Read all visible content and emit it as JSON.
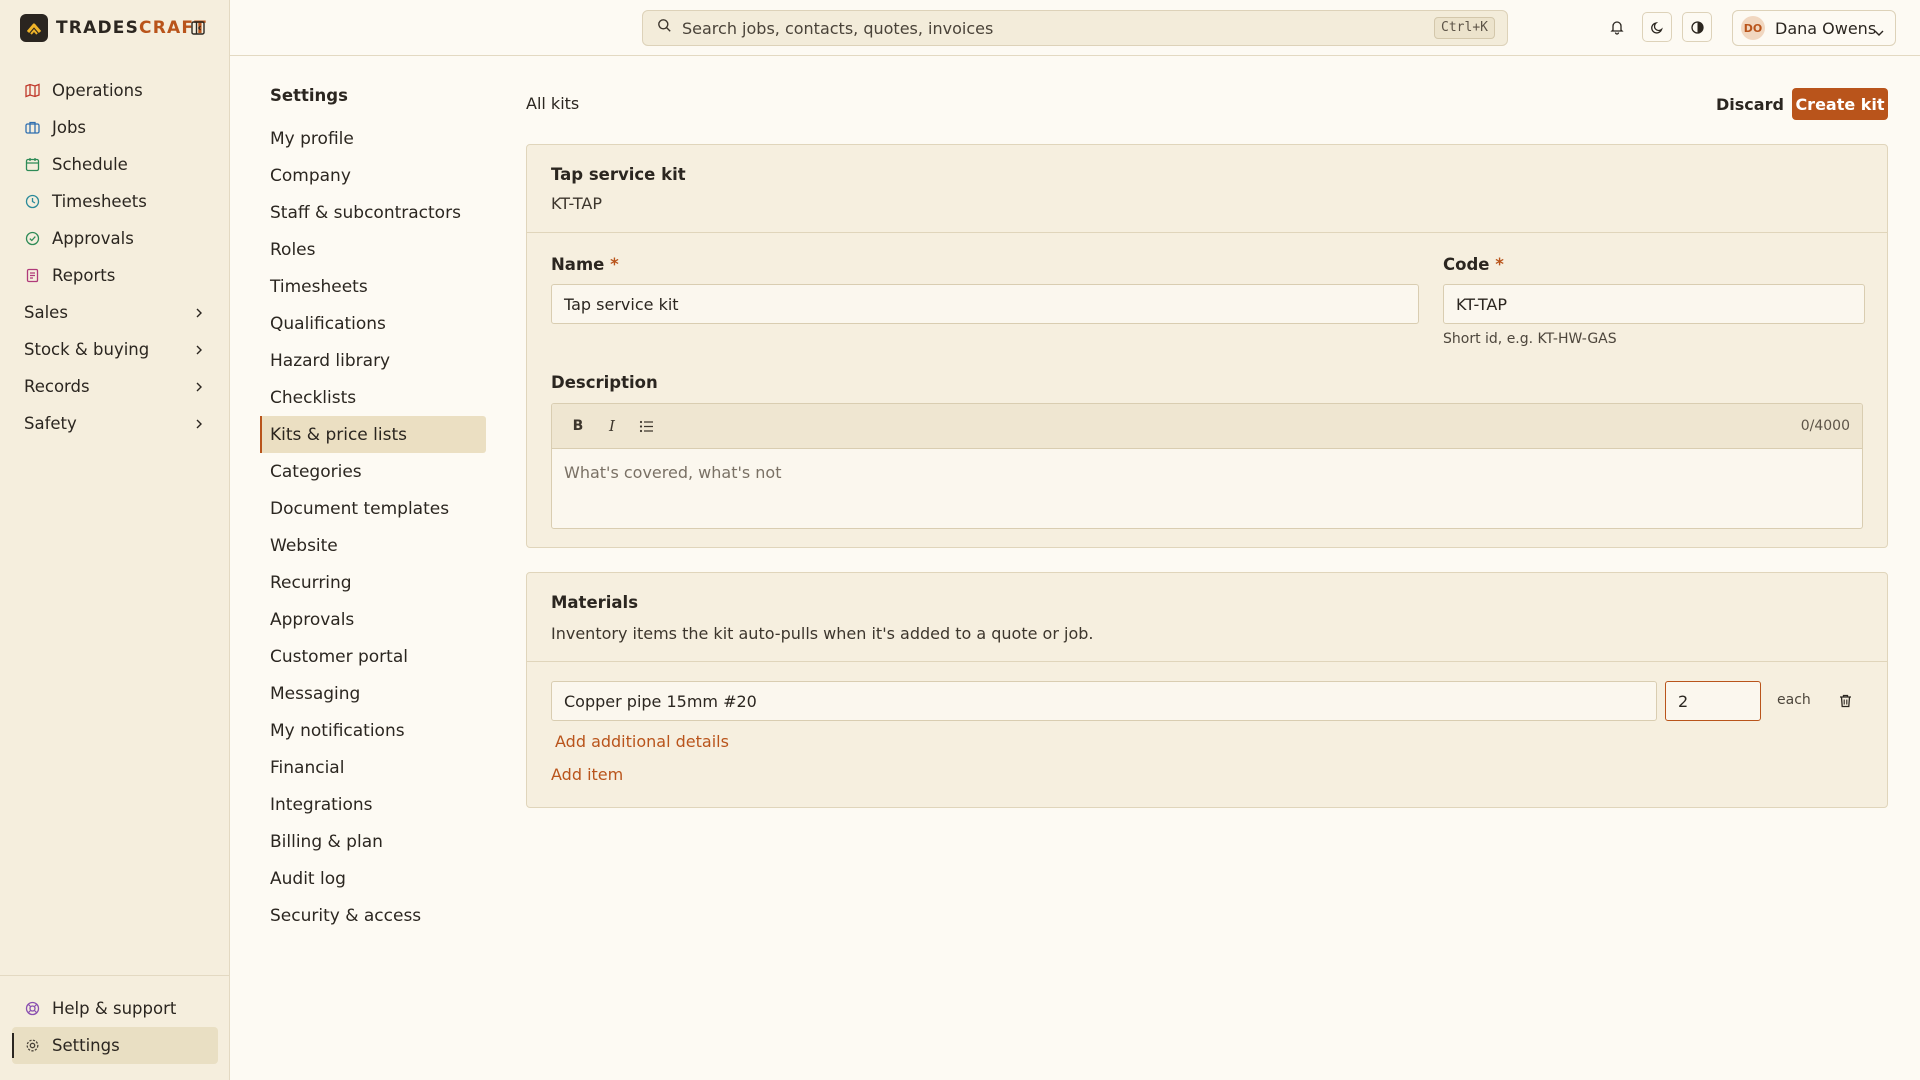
{
  "app": {
    "brand_left": "TRADES",
    "brand_right": "CRAFT",
    "accent_color": "#b9541b"
  },
  "sidebar": {
    "items": [
      {
        "label": "Operations",
        "icon": "map-icon",
        "color": "#c0392b"
      },
      {
        "label": "Jobs",
        "icon": "briefcase-icon",
        "color": "#2f6fb0"
      },
      {
        "label": "Schedule",
        "icon": "calendar-icon",
        "color": "#2e8b57"
      },
      {
        "label": "Timesheets",
        "icon": "clock-icon",
        "color": "#2a8a9a"
      },
      {
        "label": "Approvals",
        "icon": "check-circle-icon",
        "color": "#2e8b57"
      },
      {
        "label": "Reports",
        "icon": "report-icon",
        "color": "#b03a7a"
      },
      {
        "label": "Sales",
        "icon": "chevron-right-icon"
      },
      {
        "label": "Stock & buying",
        "icon": "chevron-right-icon"
      },
      {
        "label": "Records",
        "icon": "chevron-right-icon"
      },
      {
        "label": "Safety",
        "icon": "chevron-right-icon"
      }
    ],
    "bottom": [
      {
        "label": "Help & support",
        "icon": "lifebuoy-icon"
      },
      {
        "label": "Settings",
        "icon": "gear-icon"
      }
    ]
  },
  "topbar": {
    "search_placeholder": "Search jobs, contacts, quotes, invoices",
    "search_shortcut": "Ctrl+K",
    "user_initials": "DO",
    "user_name": "Dana Owens"
  },
  "settings": {
    "title": "Settings",
    "items": [
      "My profile",
      "Company",
      "Staff & subcontractors",
      "Roles",
      "Timesheets",
      "Qualifications",
      "Hazard library",
      "Checklists",
      "Kits & price lists",
      "Categories",
      "Document templates",
      "Website",
      "Recurring",
      "Approvals",
      "Customer portal",
      "Messaging",
      "My notifications",
      "Financial",
      "Integrations",
      "Billing & plan",
      "Audit log",
      "Security & access"
    ],
    "active": "Kits & price lists"
  },
  "main": {
    "breadcrumb": "All kits",
    "discard_label": "Discard",
    "create_label": "Create kit",
    "kit": {
      "title": "Tap service kit",
      "code_display": "KT-TAP",
      "name_label": "Name",
      "name_value": "Tap service kit",
      "code_label": "Code",
      "code_value": "KT-TAP",
      "code_hint": "Short id, e.g. KT-HW-GAS",
      "required_mark": "*",
      "description_label": "Description",
      "description_counter": "0/4000",
      "description_placeholder": "What's covered, what's not",
      "toolbar": {
        "bold": "B",
        "italic": "I"
      }
    },
    "materials": {
      "title": "Materials",
      "subtitle": "Inventory items the kit auto-pulls when it's added to a quote or job.",
      "rows": [
        {
          "item": "Copper pipe 15mm #20",
          "qty": "2",
          "unit": "each"
        }
      ],
      "add_details_label": "Add additional details",
      "add_item_label": "Add item"
    }
  }
}
